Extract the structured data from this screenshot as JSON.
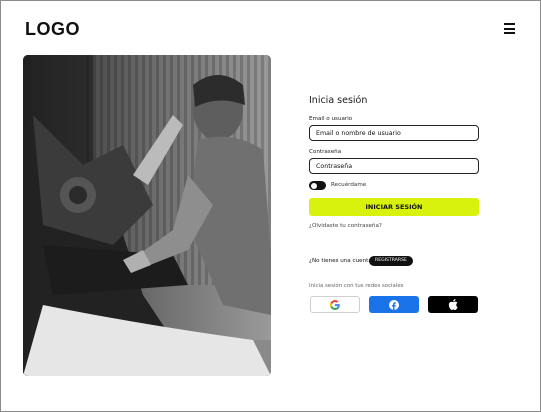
{
  "header": {
    "logo": "LOGO",
    "menu_icon": "hamburger-menu-icon"
  },
  "hero": {
    "image": "photo-mechanic-working-on-motorcycle",
    "style": "black-and-white"
  },
  "login": {
    "title": "Inicia sesión",
    "email_label": "Email o usuario",
    "email_value": "Email o nombre de usuario",
    "password_label": "Contraseña",
    "password_value": "Contraseña",
    "remember_label": "Recuérdame",
    "submit_label": "INICIAR SESIÓN",
    "forgot_label": "¿Olvidaste tu contraseña?",
    "no_account_label": "¿No tienes una cuenta?",
    "register_label": "REGISTRARSE",
    "social_label": "Inicia sesión con tus redes sociales"
  },
  "social": [
    {
      "name": "google",
      "icon": "google-icon"
    },
    {
      "name": "facebook",
      "icon": "facebook-icon"
    },
    {
      "name": "apple",
      "icon": "apple-icon"
    }
  ],
  "colors": {
    "accent": "#d8f20d",
    "facebook": "#1a73e8",
    "apple": "#000000",
    "dark": "#111111"
  }
}
